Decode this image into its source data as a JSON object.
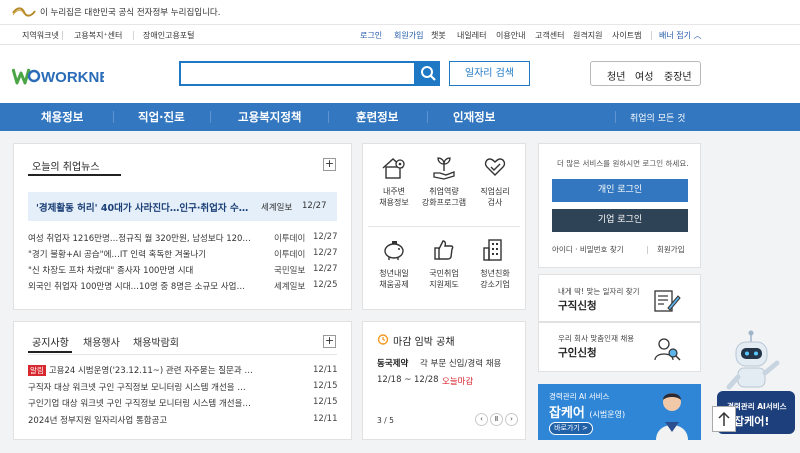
{
  "gov_banner": {
    "text": "이 누리집은 대한민국 공식 전자정부 누리집입니다."
  },
  "top_left_links": [
    "지역워크넷",
    "고용복지⁺센터",
    "장애인고용포털"
  ],
  "top_right_links": [
    "로그인",
    "회원가입",
    "챗봇",
    "내일레터",
    "이용안내",
    "고객센터",
    "원격지원",
    "사이트맵"
  ],
  "banner_toggle": "배너 접기",
  "logo": {
    "text": "WORKNET"
  },
  "search": {
    "placeholder": "",
    "job_search_label": "일자리 검색"
  },
  "audience_tabs": [
    "청년",
    "여성",
    "중장년"
  ],
  "gnb": {
    "items": [
      "채용정보",
      "직업·진로",
      "고용복지정책",
      "훈련정보",
      "인재정보"
    ],
    "all_label": "취업의 모든 것"
  },
  "news": {
    "title": "오늘의 취업뉴스",
    "headline": {
      "title": "'경제활동 허리' 40대가 사라진다…인구·취업자 수…",
      "source": "세계일보",
      "date": "12/27"
    },
    "items": [
      {
        "title": "여성 취업자 1216만명…정규직 월 320만원, 남성보다 120…",
        "source": "이투데이",
        "date": "12/27"
      },
      {
        "title": "\"경기 불황+AI 공습\"에…IT 인력 혹독한 겨울나기",
        "source": "이투데이",
        "date": "12/27"
      },
      {
        "title": "\"신 차장도 프차 차렸대\" 종사자 100만명 시대",
        "source": "국민일보",
        "date": "12/27"
      },
      {
        "title": "외국인 취업자 100만명 시대…10명 중 8명은 소규모 사업…",
        "source": "세계일보",
        "date": "12/25"
      }
    ]
  },
  "quick_menu": [
    {
      "line1": "내주변",
      "line2": "채용정보",
      "icon": "house-location-icon"
    },
    {
      "line1": "취업역량",
      "line2": "강화프로그램",
      "icon": "sprout-hand-icon"
    },
    {
      "line1": "직업심리",
      "line2": "검사",
      "icon": "heart-hand-icon"
    },
    {
      "line1": "청년내일",
      "line2": "채움공제",
      "icon": "piggy-bank-icon"
    },
    {
      "line1": "국민취업",
      "line2": "지원제도",
      "icon": "thumbs-up-icon"
    },
    {
      "line1": "청년친화",
      "line2": "강소기업",
      "icon": "building-icon"
    }
  ],
  "login": {
    "message": "더 많은 서비스를 원하시면 로그인 하세요.",
    "personal_label": "개인 로그인",
    "business_label": "기업 로그인",
    "find_label": "아이디 · 비밀번호 찾기",
    "signup_label": "회원가입"
  },
  "job_apply": {
    "sub": "내게 딱! 맞는 일자리 찾기",
    "main": "구직신청"
  },
  "hire_apply": {
    "sub": "우리 회사 맞춤인재 채용",
    "main": "구인신청"
  },
  "notice": {
    "tabs": [
      "공지사항",
      "채용행사",
      "채용박람회"
    ],
    "badge": "알림",
    "items": [
      {
        "title": "고용24 시범운영('23.12.11~) 관련 자주묻는 질문과 …",
        "date": "12/11",
        "badge": true
      },
      {
        "title": "구직자 대상 워크넷 구인 구직정보 모니터링 시스템 개선을 …",
        "date": "12/15",
        "badge": false
      },
      {
        "title": "구인기업 대상 워크넷 구인 구직정보 모니터링 시스템 개선을…",
        "date": "12/15",
        "badge": false
      },
      {
        "title": "2024년 정부지원 일자리사업 통합공고",
        "date": "12/11",
        "badge": false
      }
    ]
  },
  "deadline": {
    "title": "마감 임박 공채",
    "company": "동국제약",
    "job": "각 부문 신입/경력 채용",
    "period": "12/18 ~ 12/28",
    "today": "오늘마감",
    "page": "3 / 5"
  },
  "ai_banner": {
    "sub": "경력관리 AI 서비스",
    "title": "잡케어",
    "title_sub": "(시범운영)",
    "go": "바로가기 >"
  },
  "floating_ai": {
    "line1": "경력관리 AI서비스",
    "line2": "잡케어!"
  },
  "colors": {
    "primary": "#3277c0",
    "navy": "#2f4356",
    "red": "#d7282f",
    "green": "#4aa545"
  }
}
